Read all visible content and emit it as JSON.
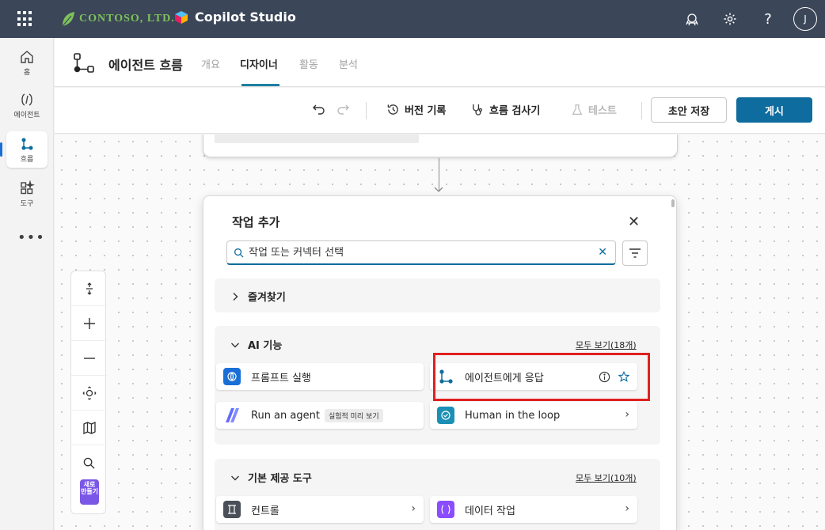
{
  "topbar": {
    "org_name": "CONTOSO, LTD.",
    "app_name": "Copilot Studio",
    "avatar_initial": "J",
    "icons": [
      "waffle-icon",
      "environment-icon",
      "settings-icon",
      "help-icon"
    ]
  },
  "leftnav": {
    "items": [
      {
        "label": "홈",
        "icon": "home-icon"
      },
      {
        "label": "에이전트",
        "icon": "agent-icon"
      },
      {
        "label": "흐름",
        "icon": "flow-icon",
        "active": true
      },
      {
        "label": "도구",
        "icon": "tools-icon"
      }
    ],
    "more": "•••"
  },
  "header": {
    "title": "에이전트 흐름",
    "tabs": [
      {
        "label": "개요"
      },
      {
        "label": "디자이너",
        "selected": true
      },
      {
        "label": "활동"
      },
      {
        "label": "분석"
      }
    ]
  },
  "toolbar": {
    "version_history": "버전 기록",
    "flow_checker": "흐름 검사기",
    "test": "테스트",
    "save_draft": "초안 저장",
    "publish": "게시"
  },
  "zoom": {
    "new_badge": "새로 만들기"
  },
  "panel": {
    "title": "작업 추가",
    "search_placeholder": "작업 또는 커넥터 선택",
    "sections": {
      "favorites": {
        "label": "즐겨찾기"
      },
      "ai": {
        "label": "AI 기능",
        "see_all": "모두 보기(18개)",
        "items": [
          {
            "label": "프롬프트 실행",
            "icon": "prompt-icon"
          },
          {
            "label": "에이전트에게 응답",
            "icon": "agent-respond-icon",
            "highlighted": true
          },
          {
            "label": "Run an agent",
            "badge": "실험적 미리 보기",
            "icon": "run-agent-icon"
          },
          {
            "label": "Human in the loop",
            "icon": "human-loop-icon"
          }
        ]
      },
      "builtin": {
        "label": "기본 제공 도구",
        "see_all": "모두 보기(10개)",
        "items": [
          {
            "label": "컨트롤",
            "icon": "control-icon"
          },
          {
            "label": "데이터 작업",
            "icon": "data-operation-icon"
          }
        ]
      }
    }
  },
  "colors": {
    "topbar": "#3b4658",
    "accent": "#0f6c9e",
    "highlight": "#e02020",
    "org_green": "#7fc25b"
  }
}
